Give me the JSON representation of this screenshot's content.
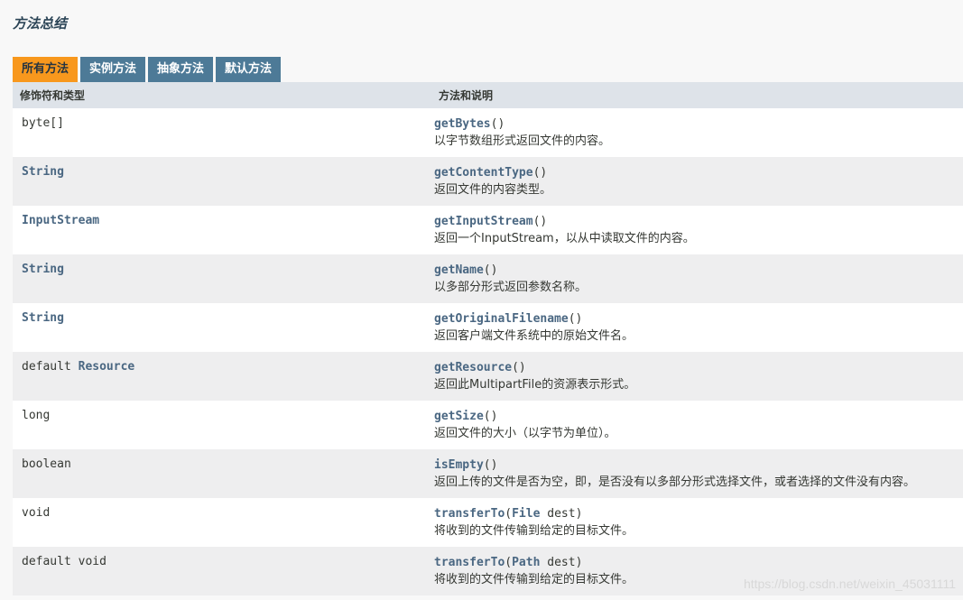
{
  "section_title": "方法总结",
  "tabs": [
    {
      "label": "所有方法"
    },
    {
      "label": "实例方法"
    },
    {
      "label": "抽象方法"
    },
    {
      "label": "默认方法"
    }
  ],
  "table": {
    "headers": {
      "modifier_type": "修饰符和类型",
      "method_desc": "方法和说明"
    },
    "rows": [
      {
        "prefix": "",
        "type": "byte[]",
        "type_linked": false,
        "method": "getBytes",
        "params_type": "",
        "params_name": "",
        "desc": "以字节数组形式返回文件的内容。"
      },
      {
        "prefix": "",
        "type": "String",
        "type_linked": true,
        "method": "getContentType",
        "params_type": "",
        "params_name": "",
        "desc": "返回文件的内容类型。"
      },
      {
        "prefix": "",
        "type": "InputStream",
        "type_linked": true,
        "method": "getInputStream",
        "params_type": "",
        "params_name": "",
        "desc": "返回一个InputStream，以从中读取文件的内容。"
      },
      {
        "prefix": "",
        "type": "String",
        "type_linked": true,
        "method": "getName",
        "params_type": "",
        "params_name": "",
        "desc": "以多部分形式返回参数名称。"
      },
      {
        "prefix": "",
        "type": "String",
        "type_linked": true,
        "method": "getOriginalFilename",
        "params_type": "",
        "params_name": "",
        "desc": "返回客户端文件系统中的原始文件名。"
      },
      {
        "prefix": "default ",
        "type": "Resource",
        "type_linked": true,
        "method": "getResource",
        "params_type": "",
        "params_name": "",
        "desc": "返回此MultipartFile的资源表示形式。"
      },
      {
        "prefix": "",
        "type": "long",
        "type_linked": false,
        "method": "getSize",
        "params_type": "",
        "params_name": "",
        "desc": "返回文件的大小（以字节为单位）。"
      },
      {
        "prefix": "",
        "type": "boolean",
        "type_linked": false,
        "method": "isEmpty",
        "params_type": "",
        "params_name": "",
        "desc": "返回上传的文件是否为空，即，是否没有以多部分形式选择文件，或者选择的文件没有内容。"
      },
      {
        "prefix": "",
        "type": "void",
        "type_linked": false,
        "method": "transferTo",
        "params_type": "File",
        "params_name": " dest",
        "desc": "将收到的文件传输到给定的目标文件。"
      },
      {
        "prefix": "default ",
        "type": "void",
        "type_linked": false,
        "method": "transferTo",
        "params_type": "Path",
        "params_name": " dest",
        "desc": "将收到的文件传输到给定的目标文件。"
      }
    ]
  },
  "watermark": "https://blog.csdn.net/weixin_45031111"
}
